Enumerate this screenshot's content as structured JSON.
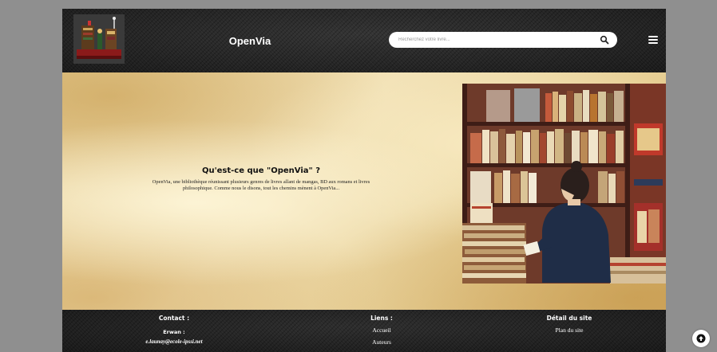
{
  "header": {
    "brand": "OpenVia",
    "search_placeholder": "Recherchez votre livre...",
    "search_icon": "magnifier-icon",
    "menu_icon": "hamburger-menu-icon",
    "logo": "lego-bookshop-logo"
  },
  "hero": {
    "title": "Qu'est-ce que \"OpenVia\" ?",
    "description": "OpenVia, une bibliothèque réunissant plusieurs genres de livres allant de mangas, BD aux romans et livres philosophique. Comme nous le disons, tout les chemins mènent à OpenVia...",
    "illustration": "woman-reading-in-bookstore-illustration"
  },
  "footer": {
    "contact": {
      "heading": "Contact :",
      "name": "Erwan :",
      "email": "e.launay@ecole-ipssi.net"
    },
    "links": {
      "heading": "Liens :",
      "items": [
        "Accueil",
        "Auteurs"
      ]
    },
    "site": {
      "heading": "Détail du site",
      "items": [
        "Plan du site"
      ]
    }
  },
  "scroll_top_icon": "arrow-up-circle-icon",
  "colors": {
    "page_bg": "#8f8f8f",
    "header_bg": "#222222",
    "parchment": "#ecd8a4",
    "text_light": "#ffffff"
  }
}
